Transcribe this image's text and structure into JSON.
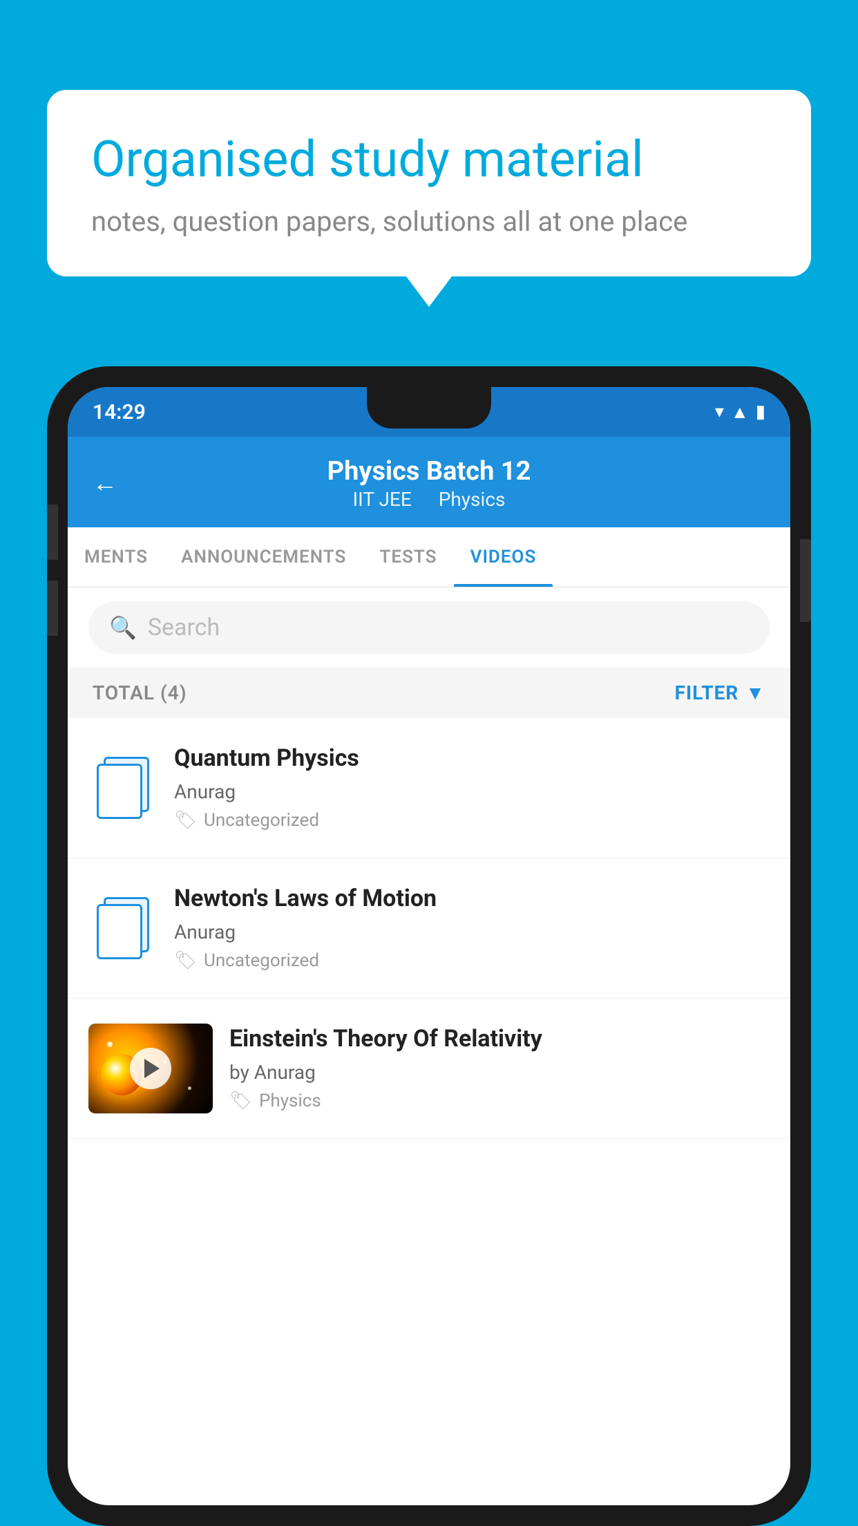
{
  "background": {
    "color": "#00AADD"
  },
  "speech_bubble": {
    "title": "Organised study material",
    "subtitle": "notes, question papers, solutions all at one place"
  },
  "phone": {
    "status_bar": {
      "time": "14:29",
      "wifi_icon": "▾",
      "signal_icon": "▲",
      "battery_icon": "▮"
    },
    "header": {
      "back_label": "←",
      "title": "Physics Batch 12",
      "subtitle_iit": "IIT JEE",
      "subtitle_physics": "Physics"
    },
    "tabs": [
      {
        "label": "MENTS",
        "active": false
      },
      {
        "label": "ANNOUNCEMENTS",
        "active": false
      },
      {
        "label": "TESTS",
        "active": false
      },
      {
        "label": "VIDEOS",
        "active": true
      }
    ],
    "search": {
      "placeholder": "Search"
    },
    "filter_bar": {
      "total_label": "TOTAL (4)",
      "filter_label": "FILTER"
    },
    "videos": [
      {
        "id": 1,
        "title": "Quantum Physics",
        "author": "Anurag",
        "tag": "Uncategorized",
        "has_thumbnail": false
      },
      {
        "id": 2,
        "title": "Newton's Laws of Motion",
        "author": "Anurag",
        "tag": "Uncategorized",
        "has_thumbnail": false
      },
      {
        "id": 3,
        "title": "Einstein's Theory Of Relativity",
        "author": "by Anurag",
        "tag": "Physics",
        "has_thumbnail": true
      }
    ]
  }
}
